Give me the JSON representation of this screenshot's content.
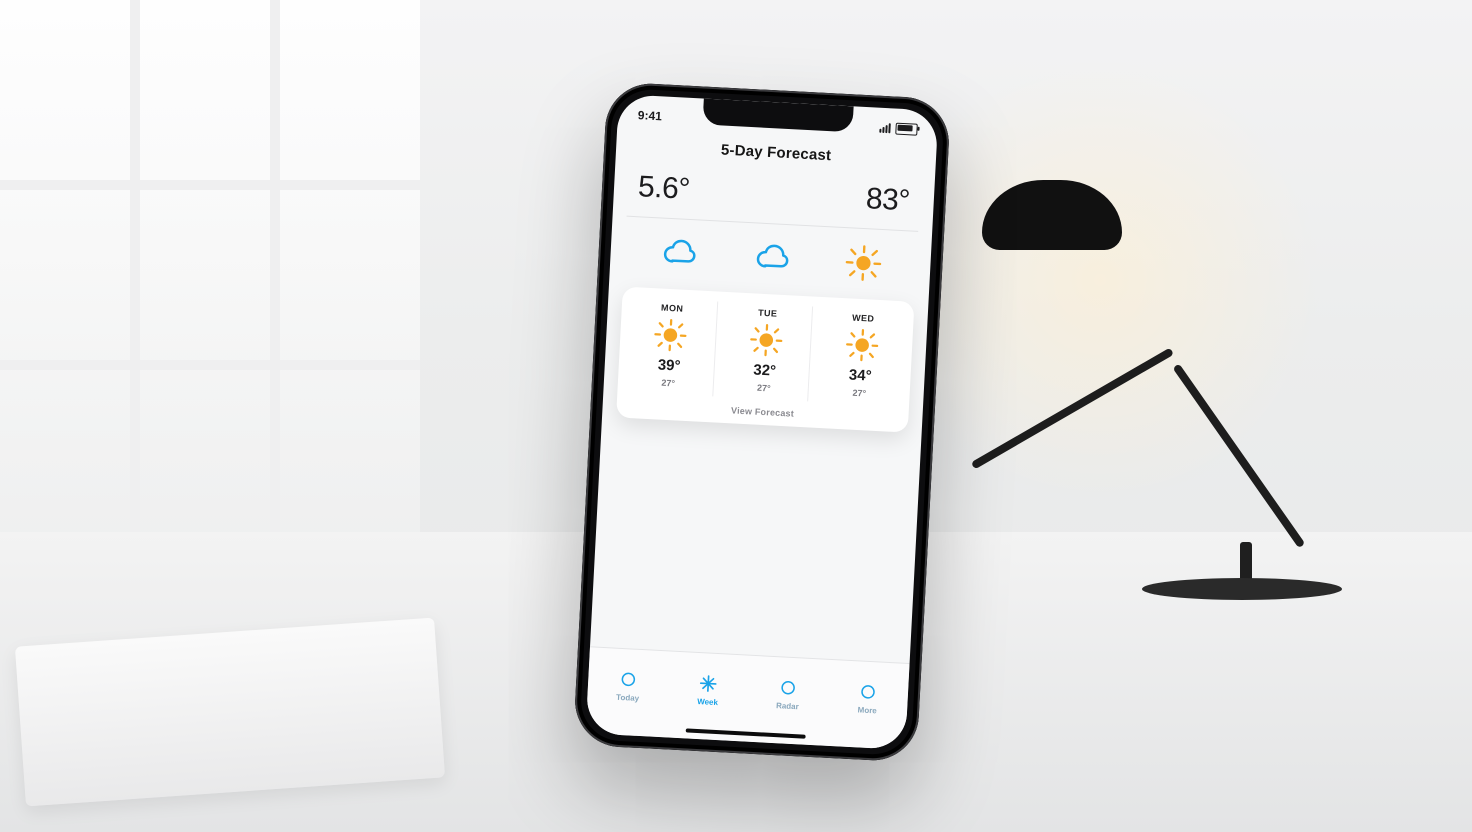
{
  "status": {
    "time": "9:41"
  },
  "header": {
    "title": "5-Day Forecast"
  },
  "hero": {
    "left_temp": "5.6°",
    "right_temp": "83°"
  },
  "today_icons": [
    "cloud",
    "cloud",
    "sun"
  ],
  "forecast": {
    "days": [
      {
        "label": "MON",
        "icon": "sun",
        "hi": "39°",
        "lo": "27°"
      },
      {
        "label": "TUE",
        "icon": "sun",
        "hi": "32°",
        "lo": "27°"
      },
      {
        "label": "WED",
        "icon": "sun",
        "hi": "34°",
        "lo": "27°"
      }
    ],
    "footer": "View Forecast"
  },
  "tabs": [
    {
      "label": "Today",
      "icon": "circle",
      "active": false
    },
    {
      "label": "Week",
      "icon": "sparkle",
      "active": true
    },
    {
      "label": "Radar",
      "icon": "circle",
      "active": false
    },
    {
      "label": "More",
      "icon": "circle",
      "active": false
    }
  ],
  "icons": {
    "cloud_stroke": "#1aa3e8",
    "sun_fill": "#f5a623"
  }
}
